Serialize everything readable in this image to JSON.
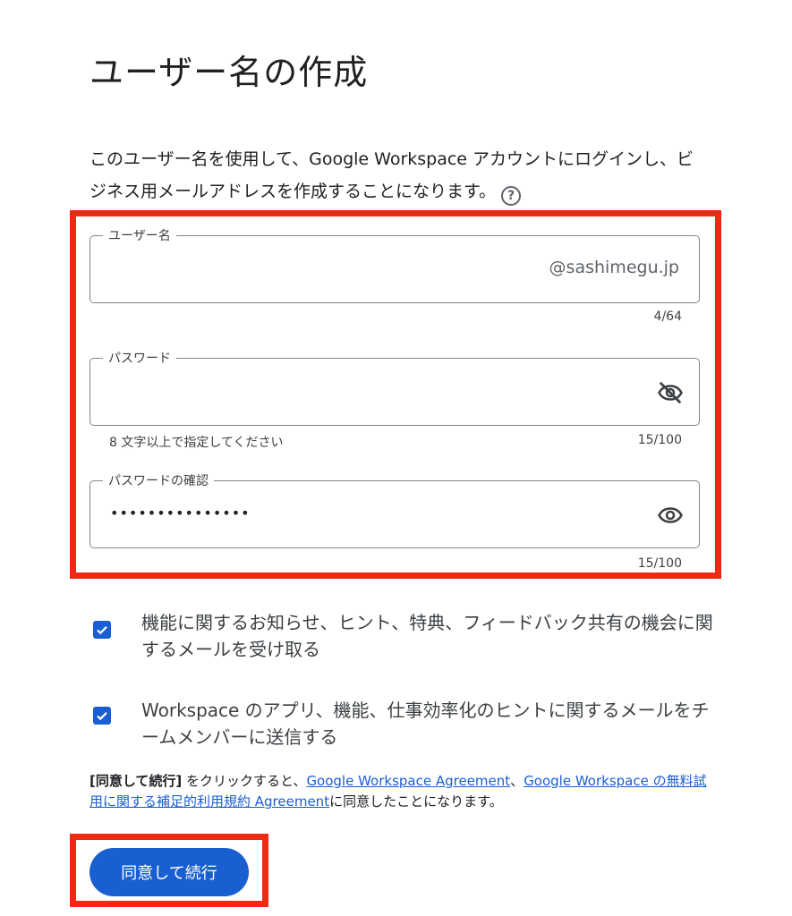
{
  "page": {
    "title": "ユーザー名の作成",
    "intro": "このユーザー名を使用して、Google Workspace アカウントにログインし、ビジネス用メールアドレスを作成することになります。"
  },
  "icons": {
    "help": "help-circle-icon",
    "eye_off": "eye-off-icon",
    "eye": "eye-icon",
    "check": "check-icon"
  },
  "username_field": {
    "label": "ユーザー名",
    "value": "",
    "suffix": "@sashimegu.jp",
    "counter": "4/64"
  },
  "password_field": {
    "label": "パスワード",
    "value": "",
    "helper": "8 文字以上で指定してください",
    "counter": "15/100"
  },
  "confirm_field": {
    "label": "パスワードの確認",
    "value": "•••••••••••••••",
    "counter": "15/100"
  },
  "checkboxes": [
    {
      "label": "機能に関するお知らせ、ヒント、特典、フィードバック共有の機会に関するメールを受け取る",
      "checked": true
    },
    {
      "label": "Workspace のアプリ、機能、仕事効率化のヒントに関するメールをチームメンバーに送信する",
      "checked": true
    }
  ],
  "terms": {
    "bold": "[同意して続行]",
    "text1": " をクリックすると、",
    "link1": "Google Workspace Agreement",
    "sep": "、",
    "link2": "Google Workspace の無料試用に関する補足的利用規約 Agreement",
    "text2": "に同意したことになります。"
  },
  "buttons": {
    "continue": "同意して続行"
  },
  "colors": {
    "primary": "#1a5fd1",
    "highlight": "#ee2a12",
    "outline": "#80868b"
  }
}
